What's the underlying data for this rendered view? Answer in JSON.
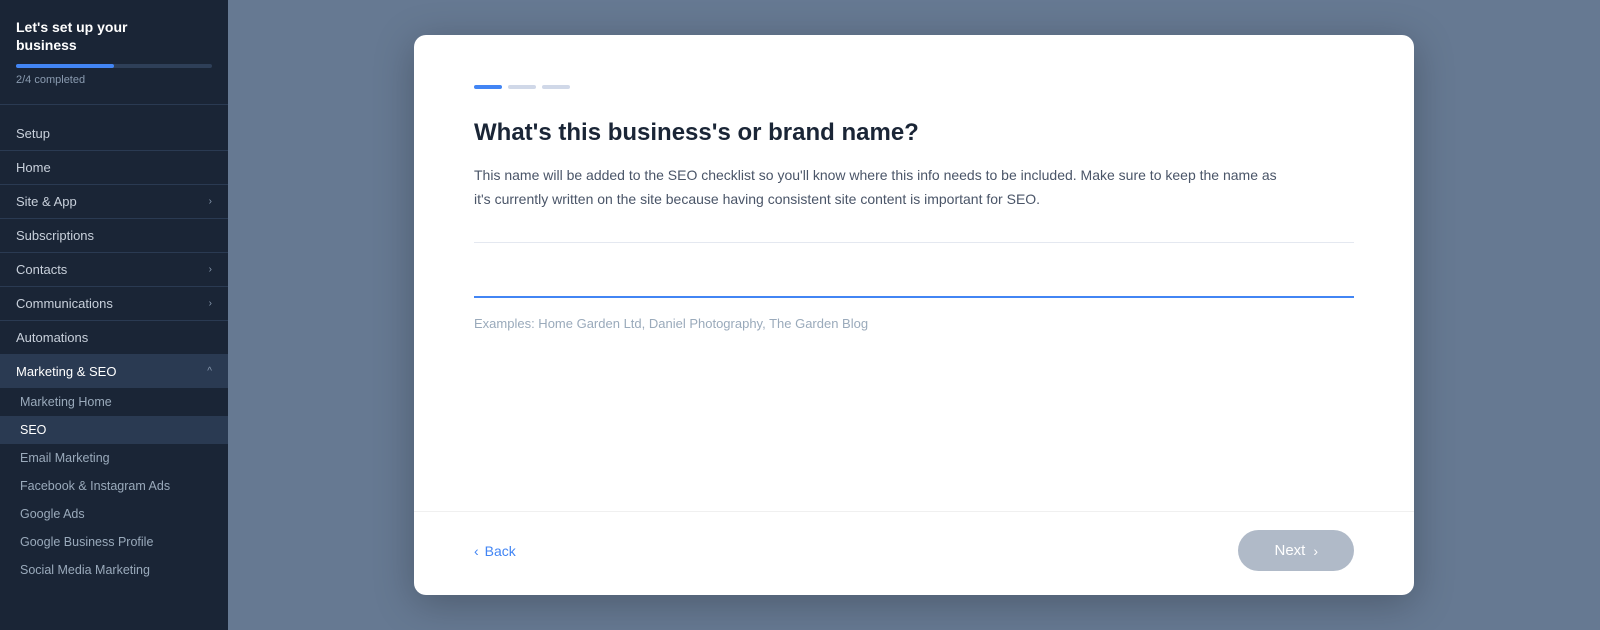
{
  "sidebar": {
    "title": "Let's set up your\nbusiness",
    "progress_text": "2/4 completed",
    "progress_percent": 50,
    "expand_icon": "›",
    "items": [
      {
        "id": "setup",
        "label": "Setup",
        "has_chevron": false,
        "active": false
      },
      {
        "id": "home",
        "label": "Home",
        "has_chevron": false,
        "active": false
      },
      {
        "id": "site-app",
        "label": "Site & App",
        "has_chevron": true,
        "active": false
      },
      {
        "id": "subscriptions",
        "label": "Subscriptions",
        "has_chevron": false,
        "active": false
      },
      {
        "id": "contacts",
        "label": "Contacts",
        "has_chevron": true,
        "active": false
      },
      {
        "id": "communications",
        "label": "Communications",
        "has_chevron": true,
        "active": false
      },
      {
        "id": "automations",
        "label": "Automations",
        "has_chevron": false,
        "active": false
      },
      {
        "id": "marketing-seo",
        "label": "Marketing & SEO",
        "has_chevron": true,
        "active": true,
        "expanded": true
      }
    ],
    "sub_items": [
      {
        "id": "marketing-home",
        "label": "Marketing Home",
        "active": false
      },
      {
        "id": "seo",
        "label": "SEO",
        "active": true
      },
      {
        "id": "email-marketing",
        "label": "Email Marketing",
        "active": false
      },
      {
        "id": "facebook-instagram",
        "label": "Facebook & Instagram Ads",
        "active": false
      },
      {
        "id": "google-ads",
        "label": "Google Ads",
        "active": false
      },
      {
        "id": "google-business",
        "label": "Google Business Profile",
        "active": false
      },
      {
        "id": "social-media",
        "label": "Social Media Marketing",
        "active": false
      }
    ]
  },
  "modal": {
    "steps": [
      {
        "id": "step1",
        "state": "active"
      },
      {
        "id": "step2",
        "state": "inactive"
      },
      {
        "id": "step3",
        "state": "inactive"
      }
    ],
    "question": "What's this business's or brand name?",
    "description": "This name will be added to the SEO checklist so you'll know where this info needs to be included. Make sure to keep the name as it's currently written on the site because having consistent site content is important for SEO.",
    "input_value": "",
    "input_examples": "Examples: Home Garden Ltd, Daniel Photography, The Garden Blog",
    "footer": {
      "back_label": "Back",
      "next_label": "Next",
      "back_chevron": "‹",
      "next_chevron": "›"
    }
  }
}
